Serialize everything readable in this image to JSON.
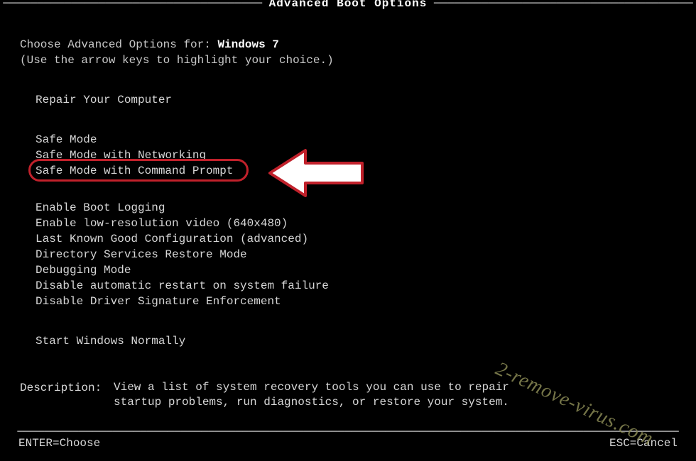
{
  "title": "Advanced Boot Options",
  "choose_prefix": "Choose Advanced Options for: ",
  "choose_os": "Windows 7",
  "hint": "(Use the arrow keys to highlight your choice.)",
  "group1": [
    "Repair Your Computer"
  ],
  "group2": [
    "Safe Mode",
    "Safe Mode with Networking",
    "Safe Mode with Command Prompt"
  ],
  "group3": [
    "Enable Boot Logging",
    "Enable low-resolution video (640x480)",
    "Last Known Good Configuration (advanced)",
    "Directory Services Restore Mode",
    "Debugging Mode",
    "Disable automatic restart on system failure",
    "Disable Driver Signature Enforcement"
  ],
  "group4": [
    "Start Windows Normally"
  ],
  "selected_index_in_group2": 2,
  "description_label": "Description:",
  "description_text": "View a list of system recovery tools you can use to repair startup problems, run diagnostics, or restore your system.",
  "footer_left": "ENTER=Choose",
  "footer_right": "ESC=Cancel",
  "watermark": "2-remove-virus.com",
  "annotation": {
    "highlight_item": "Safe Mode with Command Prompt",
    "arrow_color": "#ffffff",
    "arrow_outline": "#c1212b"
  }
}
